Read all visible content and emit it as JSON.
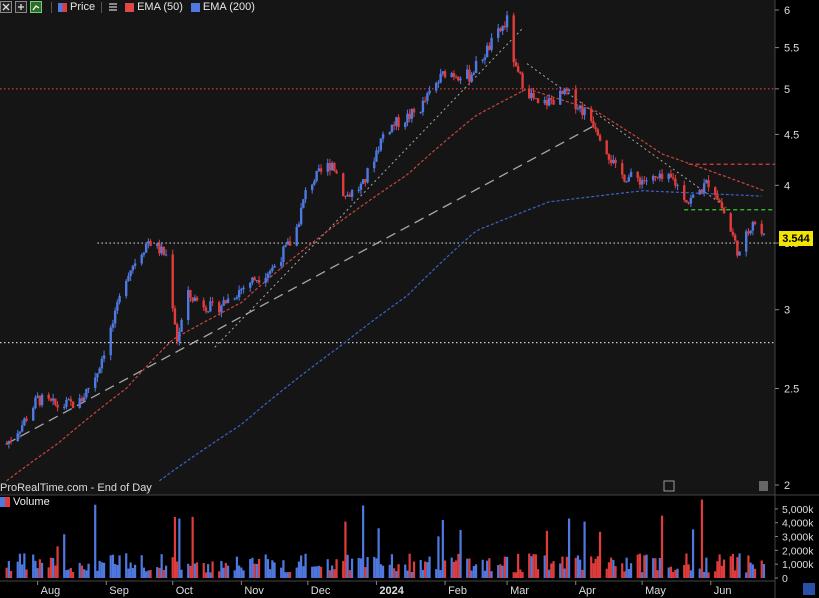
{
  "legend": {
    "price_label": "Price",
    "ema50_label": "EMA (50)",
    "ema200_label": "EMA (200)",
    "icons": [
      "close-icon",
      "expand-icon",
      "add-indicator-icon",
      "settings-icon"
    ]
  },
  "watermark": "ProRealTime.com - End of Day",
  "volume_label": "Volume",
  "last_price": "3.544",
  "colors": {
    "up": "#4f79e0",
    "down": "#e03c3c",
    "ema50": "#c8453f",
    "ema200": "#3a63c8",
    "last_tag_bg": "#f2e600",
    "background": "#000000"
  },
  "price_axis": {
    "ticks": [
      "6",
      "5.5",
      "5",
      "4.5",
      "4",
      "3.5",
      "3",
      "2.5",
      "2"
    ]
  },
  "volume_axis": {
    "ticks": [
      "5,000k",
      "4,000k",
      "3,000k",
      "2,000k",
      "1,000k",
      "0"
    ]
  },
  "x_axis": {
    "ticks": [
      "Aug",
      "Sep",
      "Oct",
      "Nov",
      "Dec",
      "2024",
      "Feb",
      "Mar",
      "Apr",
      "May",
      "Jun"
    ]
  },
  "chart_data": {
    "type": "candlestick",
    "scale": "log",
    "ylim": [
      2,
      6
    ],
    "price_checkpoints": [
      {
        "d": "Jul 18",
        "v": 2.2
      },
      {
        "d": "Jul 25",
        "v": 2.3
      },
      {
        "d": "Aug 1",
        "v": 2.44
      },
      {
        "d": "Aug 10",
        "v": 2.4
      },
      {
        "d": "Aug 20",
        "v": 2.42
      },
      {
        "d": "Aug 28",
        "v": 2.6
      },
      {
        "d": "Sep 5",
        "v": 2.95
      },
      {
        "d": "Sep 10",
        "v": 3.25
      },
      {
        "d": "Sep 20",
        "v": 3.52
      },
      {
        "d": "Sep 28",
        "v": 3.4
      },
      {
        "d": "Oct 3",
        "v": 2.8
      },
      {
        "d": "Oct 8",
        "v": 3.1
      },
      {
        "d": "Oct 20",
        "v": 3.0
      },
      {
        "d": "Nov 5",
        "v": 3.2
      },
      {
        "d": "Nov 15",
        "v": 3.3
      },
      {
        "d": "Nov 25",
        "v": 3.55
      },
      {
        "d": "Dec 1",
        "v": 4.0
      },
      {
        "d": "Dec 12",
        "v": 4.22
      },
      {
        "d": "Dec 18",
        "v": 3.9
      },
      {
        "d": "Dec 26",
        "v": 4.0
      },
      {
        "d": "Jan 5",
        "v": 4.55
      },
      {
        "d": "Jan 20",
        "v": 4.75
      },
      {
        "d": "Feb 1",
        "v": 5.2
      },
      {
        "d": "Feb 12",
        "v": 5.15
      },
      {
        "d": "Feb 22",
        "v": 5.55
      },
      {
        "d": "Mar 1",
        "v": 5.85
      },
      {
        "d": "Mar 5",
        "v": 5.2
      },
      {
        "d": "Mar 15",
        "v": 4.8
      },
      {
        "d": "Mar 28",
        "v": 4.95
      },
      {
        "d": "Apr 10",
        "v": 4.6
      },
      {
        "d": "Apr 20",
        "v": 4.1
      },
      {
        "d": "May 1",
        "v": 4.05
      },
      {
        "d": "May 15",
        "v": 4.05
      },
      {
        "d": "May 22",
        "v": 3.85
      },
      {
        "d": "Jun 1",
        "v": 4.05
      },
      {
        "d": "Jun 8",
        "v": 3.7
      },
      {
        "d": "Jun 14",
        "v": 3.4
      },
      {
        "d": "Jun 20",
        "v": 3.7
      },
      {
        "d": "Jun 25",
        "v": 3.544
      }
    ],
    "ema50_checkpoints": [
      {
        "d": "Jul 18",
        "v": 2.02
      },
      {
        "d": "Aug 10",
        "v": 2.2
      },
      {
        "d": "Sep 10",
        "v": 2.5
      },
      {
        "d": "Oct 1",
        "v": 2.8
      },
      {
        "d": "Nov 1",
        "v": 3.05
      },
      {
        "d": "Dec 10",
        "v": 3.6
      },
      {
        "d": "Jan 15",
        "v": 4.1
      },
      {
        "d": "Feb 15",
        "v": 4.7
      },
      {
        "d": "Mar 10",
        "v": 5.0
      },
      {
        "d": "Apr 10",
        "v": 4.75
      },
      {
        "d": "May 10",
        "v": 4.3
      },
      {
        "d": "Jun 25",
        "v": 3.95
      }
    ],
    "ema200_checkpoints": [
      {
        "d": "Sep 25",
        "v": 2.02
      },
      {
        "d": "Nov 1",
        "v": 2.3
      },
      {
        "d": "Dec 15",
        "v": 2.75
      },
      {
        "d": "Jan 15",
        "v": 3.1
      },
      {
        "d": "Feb 15",
        "v": 3.6
      },
      {
        "d": "Mar 20",
        "v": 3.85
      },
      {
        "d": "May 1",
        "v": 3.95
      },
      {
        "d": "Jun 25",
        "v": 3.9
      }
    ],
    "horizontal_levels": [
      {
        "v": 5.0,
        "style": "dotted",
        "color": "#e03c3c"
      },
      {
        "v": 3.5,
        "style": "dotted",
        "color": "#cccccc"
      },
      {
        "v": 2.78,
        "style": "dotted",
        "color": "#cccccc"
      },
      {
        "v": 4.2,
        "style": "dashed",
        "color": "#e03c3c"
      },
      {
        "v": 3.78,
        "style": "dashed",
        "color": "#33cc33"
      }
    ],
    "trendlines": [
      {
        "from": {
          "d": "Jul 18",
          "v": 2.2
        },
        "to": {
          "d": "Apr 10",
          "v": 4.6
        },
        "style": "dashed",
        "color": "#cccccc"
      },
      {
        "from": {
          "d": "Oct 20",
          "v": 2.75
        },
        "to": {
          "d": "Mar 8",
          "v": 5.75
        },
        "style": "dotted",
        "color": "#cccccc"
      },
      {
        "from": {
          "d": "Mar 10",
          "v": 5.3
        },
        "to": {
          "d": "Jun 8",
          "v": 3.8
        },
        "style": "dotted",
        "color": "#cccccc"
      }
    ],
    "volume_range": [
      0,
      5500
    ]
  }
}
